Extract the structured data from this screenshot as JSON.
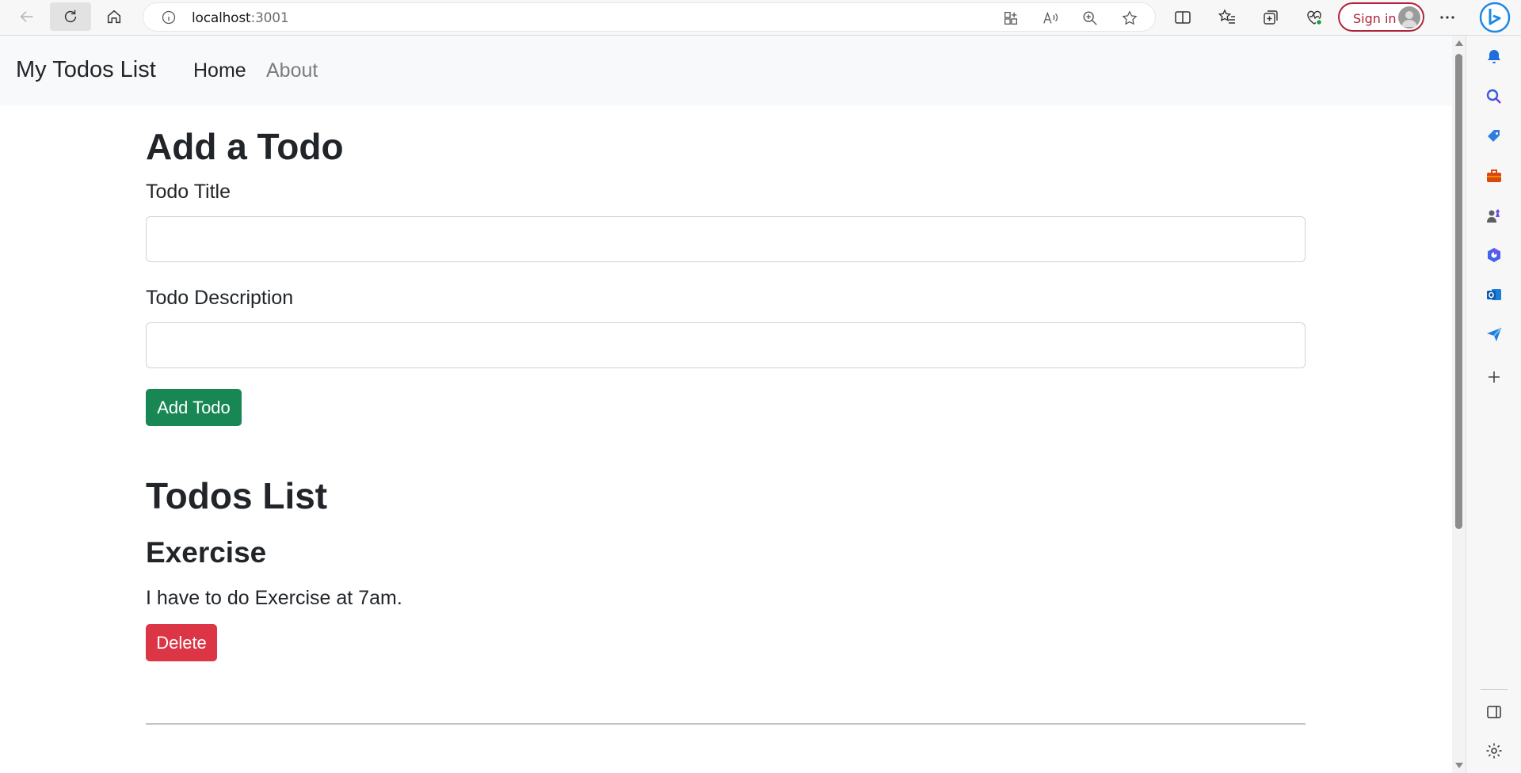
{
  "browser": {
    "url_host": "localhost",
    "url_port": ":3001",
    "signin_label": "Sign in"
  },
  "navbar": {
    "brand": "My Todos List",
    "links": [
      {
        "label": "Home",
        "active": true
      },
      {
        "label": "About",
        "active": false
      }
    ]
  },
  "add_form": {
    "heading": "Add a Todo",
    "title_label": "Todo Title",
    "title_value": "",
    "description_label": "Todo Description",
    "description_value": "",
    "submit_label": "Add Todo"
  },
  "todos": {
    "heading": "Todos List",
    "items": [
      {
        "title": "Exercise",
        "description": "I have to do Exercise at 7am.",
        "delete_label": "Delete"
      }
    ]
  },
  "colors": {
    "success": "#198754",
    "danger": "#dc3545",
    "navbar_bg": "#f8f9fa",
    "signin_accent": "#b0243a"
  },
  "icons": {
    "toolbar": [
      "back-icon",
      "reload-icon",
      "home-icon",
      "info-icon",
      "app-available-icon",
      "read-aloud-icon",
      "zoom-icon",
      "favorite-star-icon",
      "split-screen-icon",
      "favorites-icon",
      "collections-icon",
      "browser-essentials-icon",
      "avatar-icon",
      "more-icon",
      "copilot-icon"
    ],
    "sidebar": [
      "notifications-bell-icon",
      "search-icon",
      "shopping-tag-icon",
      "tools-briefcase-icon",
      "games-icon",
      "microsoft-365-icon",
      "outlook-icon",
      "send-icon",
      "add-icon",
      "sidebar-toggle-icon",
      "settings-icon"
    ]
  }
}
